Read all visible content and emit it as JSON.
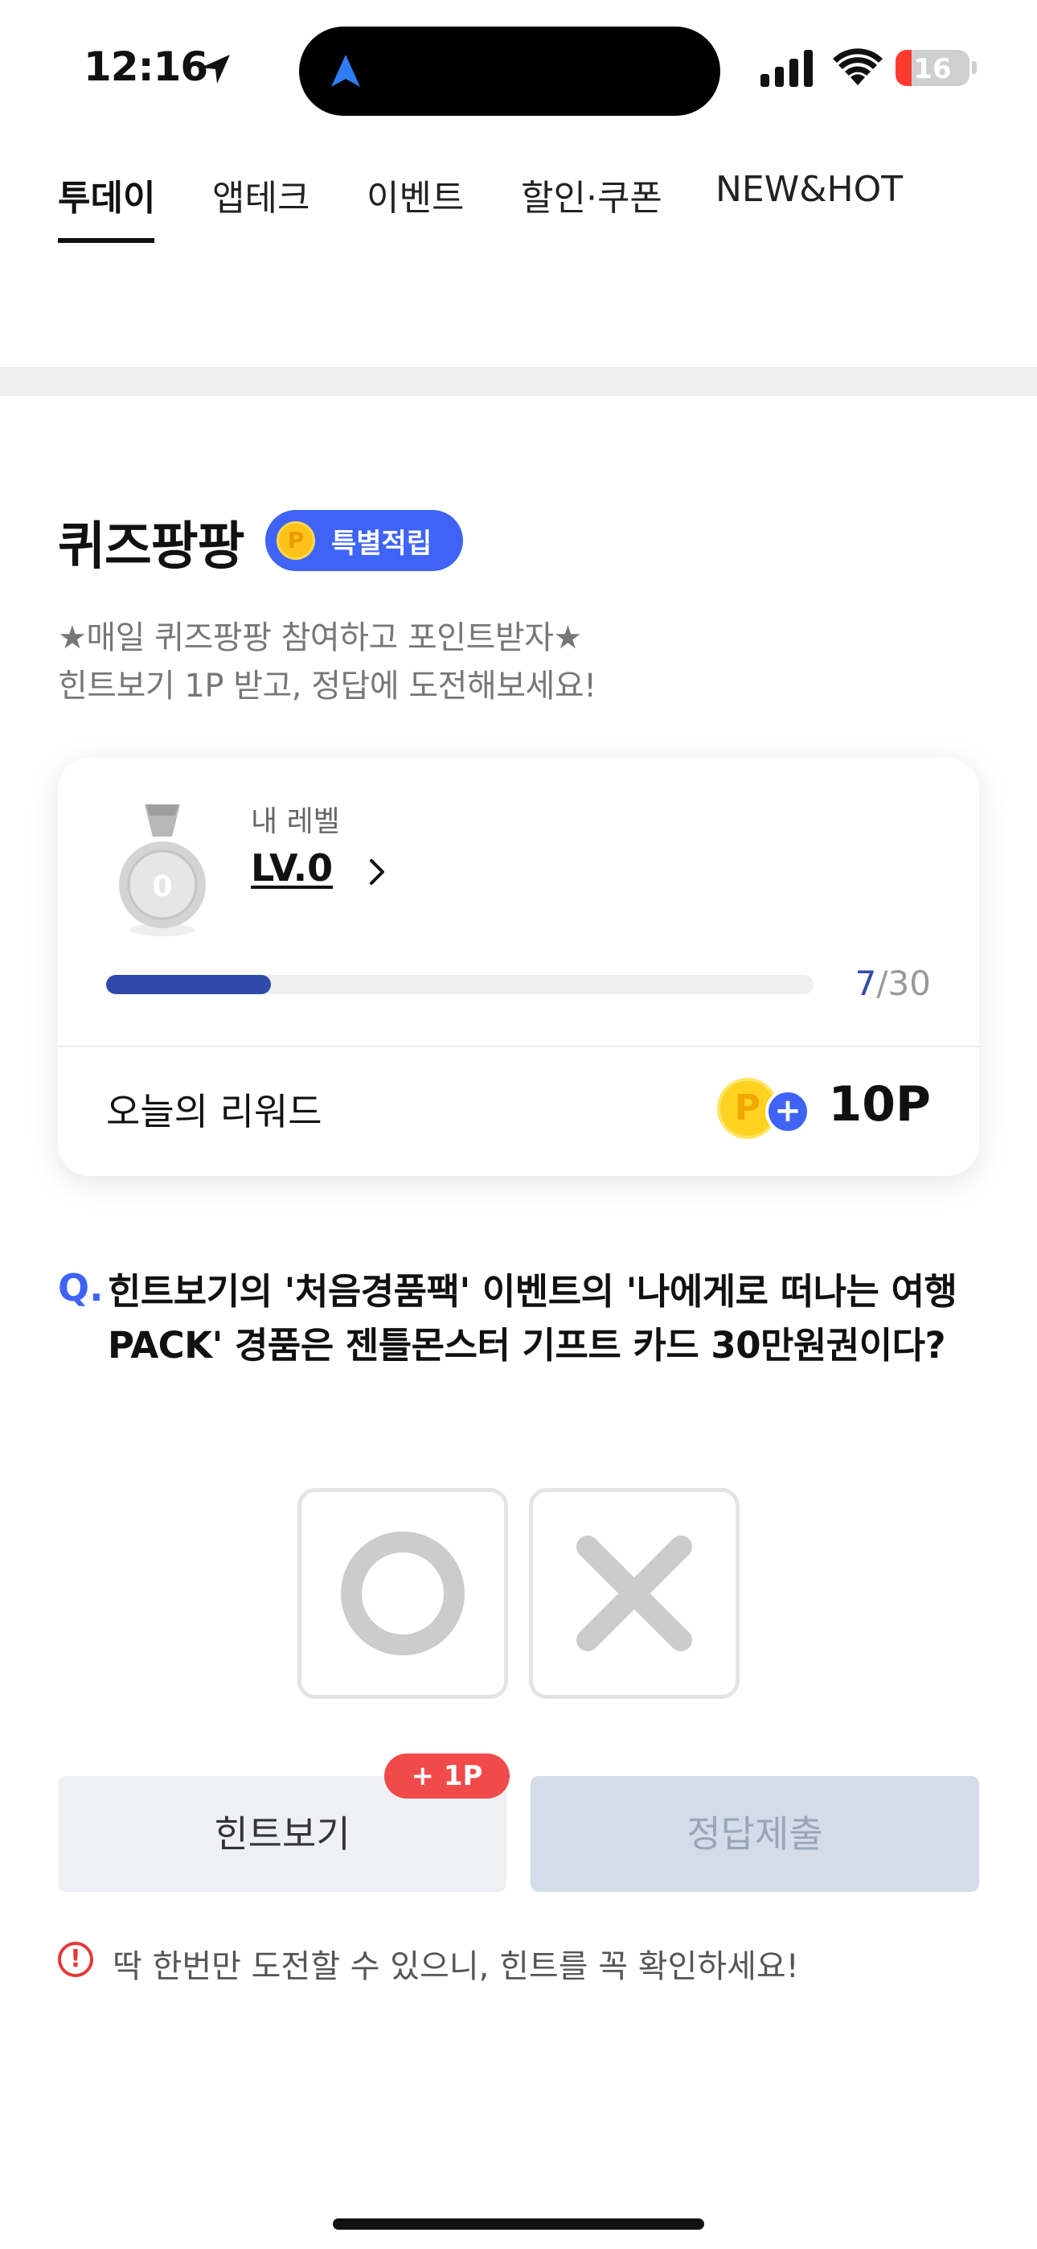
{
  "status_bar": {
    "time": "12:16",
    "battery": "16"
  },
  "tabs": [
    {
      "label": "투데이",
      "active": true
    },
    {
      "label": "앱테크",
      "active": false
    },
    {
      "label": "이벤트",
      "active": false
    },
    {
      "label": "할인·쿠폰",
      "active": false
    },
    {
      "label": "NEW&HOT",
      "active": false
    }
  ],
  "quiz": {
    "title": "퀴즈팡팡",
    "badge_label": "특별적립",
    "badge_coin": "P",
    "description_line1": "★매일 퀴즈팡팡 참여하고 포인트받자★",
    "description_line2": "힌트보기 1P 받고, 정답에 도전해보세요!"
  },
  "level_card": {
    "caption": "내 레벨",
    "level": "LV.0",
    "medal_number": "0",
    "progress_current": "7",
    "progress_total": "/30",
    "progress_fraction": 0.233,
    "reward_label": "오늘의 리워드",
    "reward_coin": "P",
    "reward_plus": "+",
    "reward_value": "10P"
  },
  "question": {
    "prefix": "Q.",
    "text": "힌트보기의 '처음경품팩' 이벤트의 '나에게로 떠나는 여행PACK' 경품은 젠틀몬스터 기프트 카드 30만원권이다?"
  },
  "buttons": {
    "hint": "힌트보기",
    "hint_badge": "+ 1P",
    "submit": "정답제출"
  },
  "notice": {
    "icon": "!",
    "text": "딱 한번만 도전할 수 있으니, 힌트를 꼭 확인하세요!"
  },
  "colors": {
    "accent": "#3f64f5",
    "progress": "#2f4aa8",
    "alert": "#f14a4a"
  }
}
